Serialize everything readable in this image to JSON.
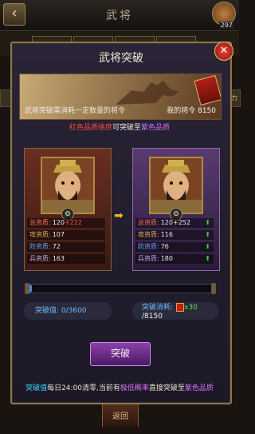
{
  "header": {
    "title": "武将",
    "avatar_badge": "297"
  },
  "side_tab_label": "力",
  "bottom_back_label": "返回",
  "dialog": {
    "title": "武将突破",
    "banner_desc": "武将突破需消耗一定数量的将令",
    "my_token_label": "我的将令",
    "my_token_value": "8150",
    "quality_from": "红色品质徐庶",
    "quality_mid": "可突破至",
    "quality_to": "紫色品质"
  },
  "left_stats": [
    {
      "label": "总资质:",
      "value": "120",
      "extra": "+222",
      "key": "total"
    },
    {
      "label": "攻资质:",
      "value": "107",
      "extra": "",
      "key": "atk"
    },
    {
      "label": "防资质:",
      "value": "72",
      "extra": "",
      "key": "def"
    },
    {
      "label": "兵资质:",
      "value": "163",
      "extra": "",
      "key": "trp"
    }
  ],
  "right_stats": [
    {
      "label": "总资质:",
      "value": "120",
      "extra": "+252",
      "key": "total"
    },
    {
      "label": "攻资质:",
      "value": "116",
      "extra": "",
      "key": "atk"
    },
    {
      "label": "防资质:",
      "value": "76",
      "extra": "",
      "key": "def"
    },
    {
      "label": "兵资质:",
      "value": "180",
      "extra": "",
      "key": "trp"
    }
  ],
  "progress": {
    "label": "突破值:",
    "value": "0/3600",
    "fraction": 0.0
  },
  "cost": {
    "label": "突破消耗:",
    "count": "x30",
    "total": "/8150"
  },
  "break_button": "突破",
  "footer": {
    "part1": "突破值",
    "part2": "每日24:00清零,当前有",
    "part3": "极低概率",
    "part4": "直接突破至",
    "part5": "紫色品质"
  },
  "colors": {
    "quality_red": "#ff4a4a",
    "quality_purple": "#d070ff",
    "accent_blue": "#6ab8ff",
    "arrow_up": "#4ad040"
  }
}
